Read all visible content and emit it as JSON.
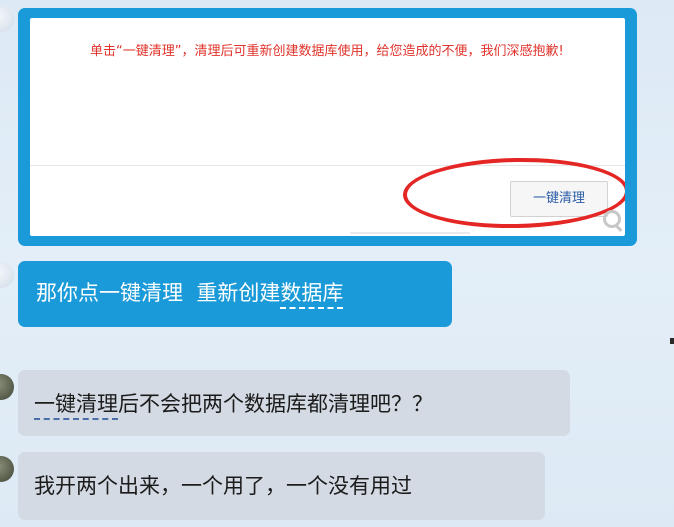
{
  "messages": [
    {
      "type": "image",
      "notice_text": "单击“一键清理”，清理后可重新创建数据库使用，给您造成的不便，我们深感抱歉!",
      "button_label": "一键清理"
    },
    {
      "type": "text",
      "plain": "那你点一键清理  重新创建",
      "link": "数据库"
    },
    {
      "type": "text",
      "link": "一键清理",
      "plain": "后不会把两个数据库都清理吧？？"
    },
    {
      "type": "text",
      "plain": "我开两个出来，一个用了，一个没有用过"
    }
  ],
  "colors": {
    "my_bubble": "#1a9ad8",
    "other_bubble": "#d3dae3",
    "notice_text": "#e0332b",
    "highlight_ellipse": "#e42624"
  }
}
